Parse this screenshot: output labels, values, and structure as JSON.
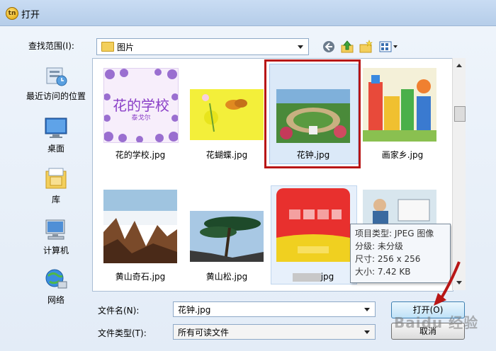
{
  "window": {
    "title": "打开",
    "app_icon": "app-icon"
  },
  "toolbar": {
    "look_in_label": "查找范围(I):",
    "look_in_value": "图片",
    "icons": [
      "back-icon",
      "up-folder-icon",
      "new-folder-icon",
      "view-menu-icon"
    ]
  },
  "places": [
    {
      "label": "最近访问的位置",
      "icon": "recent-places-icon"
    },
    {
      "label": "桌面",
      "icon": "desktop-icon"
    },
    {
      "label": "库",
      "icon": "libraries-icon"
    },
    {
      "label": "计算机",
      "icon": "computer-icon"
    },
    {
      "label": "网络",
      "icon": "network-icon"
    }
  ],
  "files": [
    {
      "name": "花的学校.jpg",
      "thumb_text": "花的学校",
      "thumb_sub": "泰戈尔"
    },
    {
      "name": "花蝴蝶.jpg"
    },
    {
      "name": "花钟.jpg",
      "selected": true
    },
    {
      "name": "画家乡.jpg"
    },
    {
      "name": "黄山奇石.jpg"
    },
    {
      "name": "黄山松.jpg"
    },
    {
      "name": "jpg",
      "hovered": true
    },
    {
      "name": ""
    }
  ],
  "tooltip": {
    "type": "项目类型: JPEG 图像",
    "rating": "分级: 未分级",
    "dimensions": "尺寸: 256 x 256",
    "size": "大小: 7.42 KB"
  },
  "form": {
    "filename_label": "文件名(N):",
    "filename_value": "花钟.jpg",
    "filetype_label": "文件类型(T):",
    "filetype_value": "所有可读文件"
  },
  "buttons": {
    "open": "打开(O)",
    "cancel": "取消"
  },
  "watermark": "Baidu 经验",
  "colors": {
    "selection_highlight": "#b81616",
    "annotation_arrow": "#b81616",
    "title_bar": "#c9dcf3"
  }
}
